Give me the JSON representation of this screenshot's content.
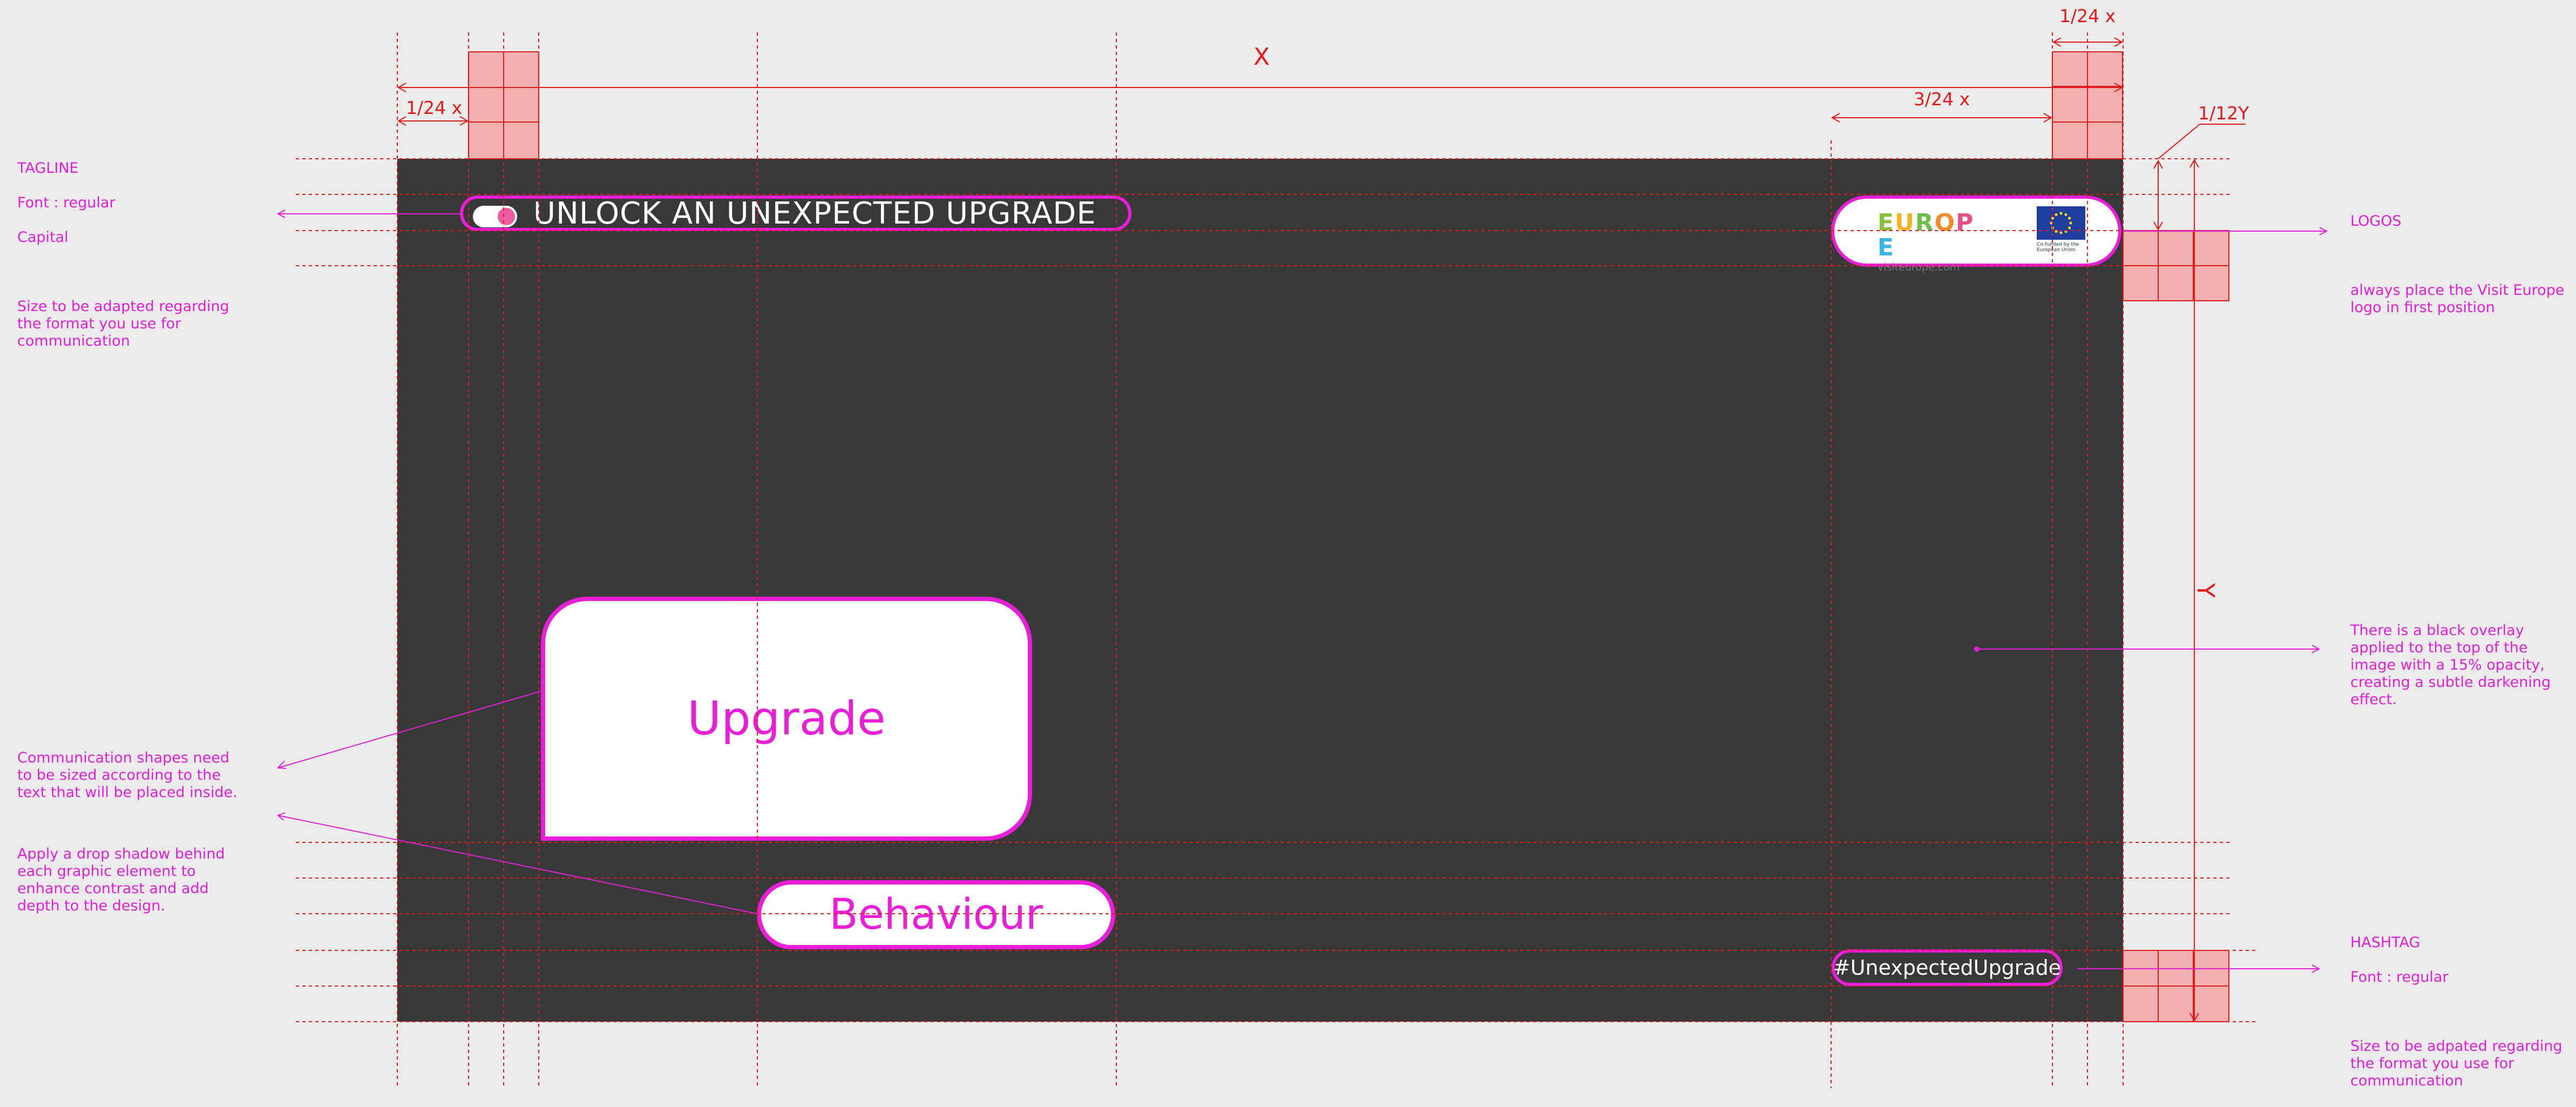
{
  "colors": {
    "background": "#ebebeb",
    "canvas": "#393838",
    "guide": "#e01a1a",
    "accent": "#e81ed8",
    "grid_fill": "#f2a9a9"
  },
  "dimensions": {
    "x": "X",
    "y": "Y",
    "margin_left": "1/24 x",
    "margin_right_top": "1/24 x",
    "logo_width": "3/24 x",
    "logo_margin": "1/12Y"
  },
  "annotations": {
    "tagline": {
      "title": "TAGLINE",
      "font": "Font : regular",
      "case": "Capital",
      "note": "Size to be adapted regarding the format you use for communication"
    },
    "logos": {
      "title": "LOGOS",
      "note": "always place the Visit Europe logo in first position"
    },
    "overlay": {
      "note": "There is a black overlay applied to the top of the image with a 15% opacity, creating a subtle darkening effect."
    },
    "shapes": {
      "note1": "Communication shapes need to be sized according to the text that will be placed inside.",
      "note2": "Apply a drop shadow behind each graphic element to enhance contrast and add depth to the design."
    },
    "hashtag": {
      "title": "HASHTAG",
      "font": "Font : regular",
      "note": "Size to be adpated regarding the format you use for communication"
    }
  },
  "design": {
    "tagline_text": "UNLOCK AN UNEXPECTED UPGRADE",
    "logo_visiteurope_word": [
      "E",
      "U",
      "R",
      "O",
      "P",
      "E"
    ],
    "logo_visiteurope_colors": [
      "#8dbf3f",
      "#f3b21b",
      "#6cc04a",
      "#f28c28",
      "#e84e8a",
      "#3bb3e3"
    ],
    "logo_visiteurope_url": "visiteurope.com",
    "logo_eu_caption": "Co-funded by the European Union",
    "bubble_text": "Upgrade",
    "pill_text": "Behaviour",
    "hashtag_text": "#UnexpectedUpgrade"
  }
}
